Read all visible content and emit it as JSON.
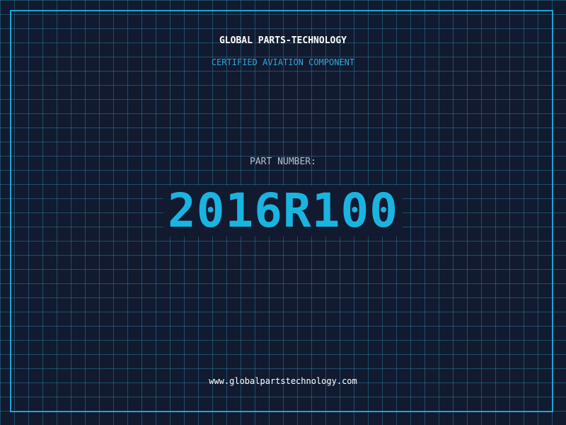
{
  "header": {
    "company": "GLOBAL PARTS-TECHNOLOGY",
    "tagline": "CERTIFIED AVIATION COMPONENT"
  },
  "part": {
    "label": "PART NUMBER:",
    "number": "2016R100"
  },
  "footer": {
    "website": "www.globalpartstechnology.com"
  },
  "colors": {
    "background": "#121a30",
    "grid": "#28789a",
    "accent": "#1ab4e0",
    "frame": "#1ba7d3"
  }
}
